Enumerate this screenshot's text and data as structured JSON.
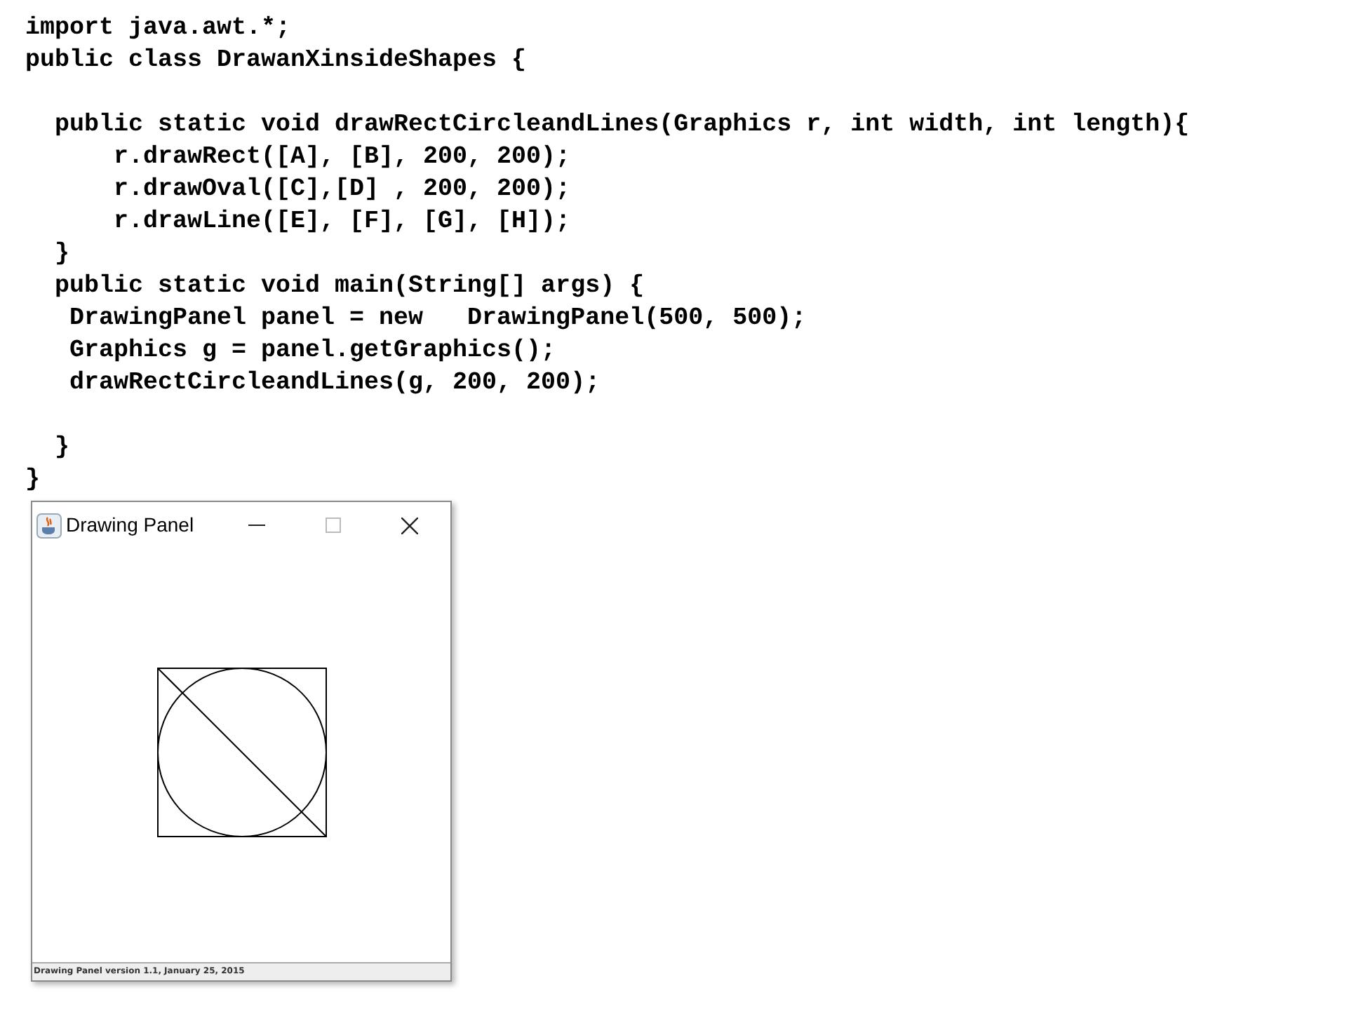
{
  "code_blocks": [
    [
      "import java.awt.*;",
      "public class DrawanXinsideShapes {"
    ],
    [
      "  public static void drawRectCircleandLines(Graphics r, int width, int length){",
      "      r.drawRect([A], [B], 200, 200);",
      "      r.drawOval([C],[D] , 200, 200);",
      "      r.drawLine([E], [F], [G], [H]);",
      "  }",
      "  public static void main(String[] args) {",
      "   DrawingPanel panel = new   DrawingPanel(500, 500);",
      "   Graphics g = panel.getGraphics();",
      "   drawRectCircleandLines(g, 200, 200);"
    ],
    [
      "  }",
      "}"
    ]
  ],
  "window": {
    "title": "Drawing Panel",
    "status_bar": "Drawing Panel version 1.1, January 25, 2015"
  }
}
